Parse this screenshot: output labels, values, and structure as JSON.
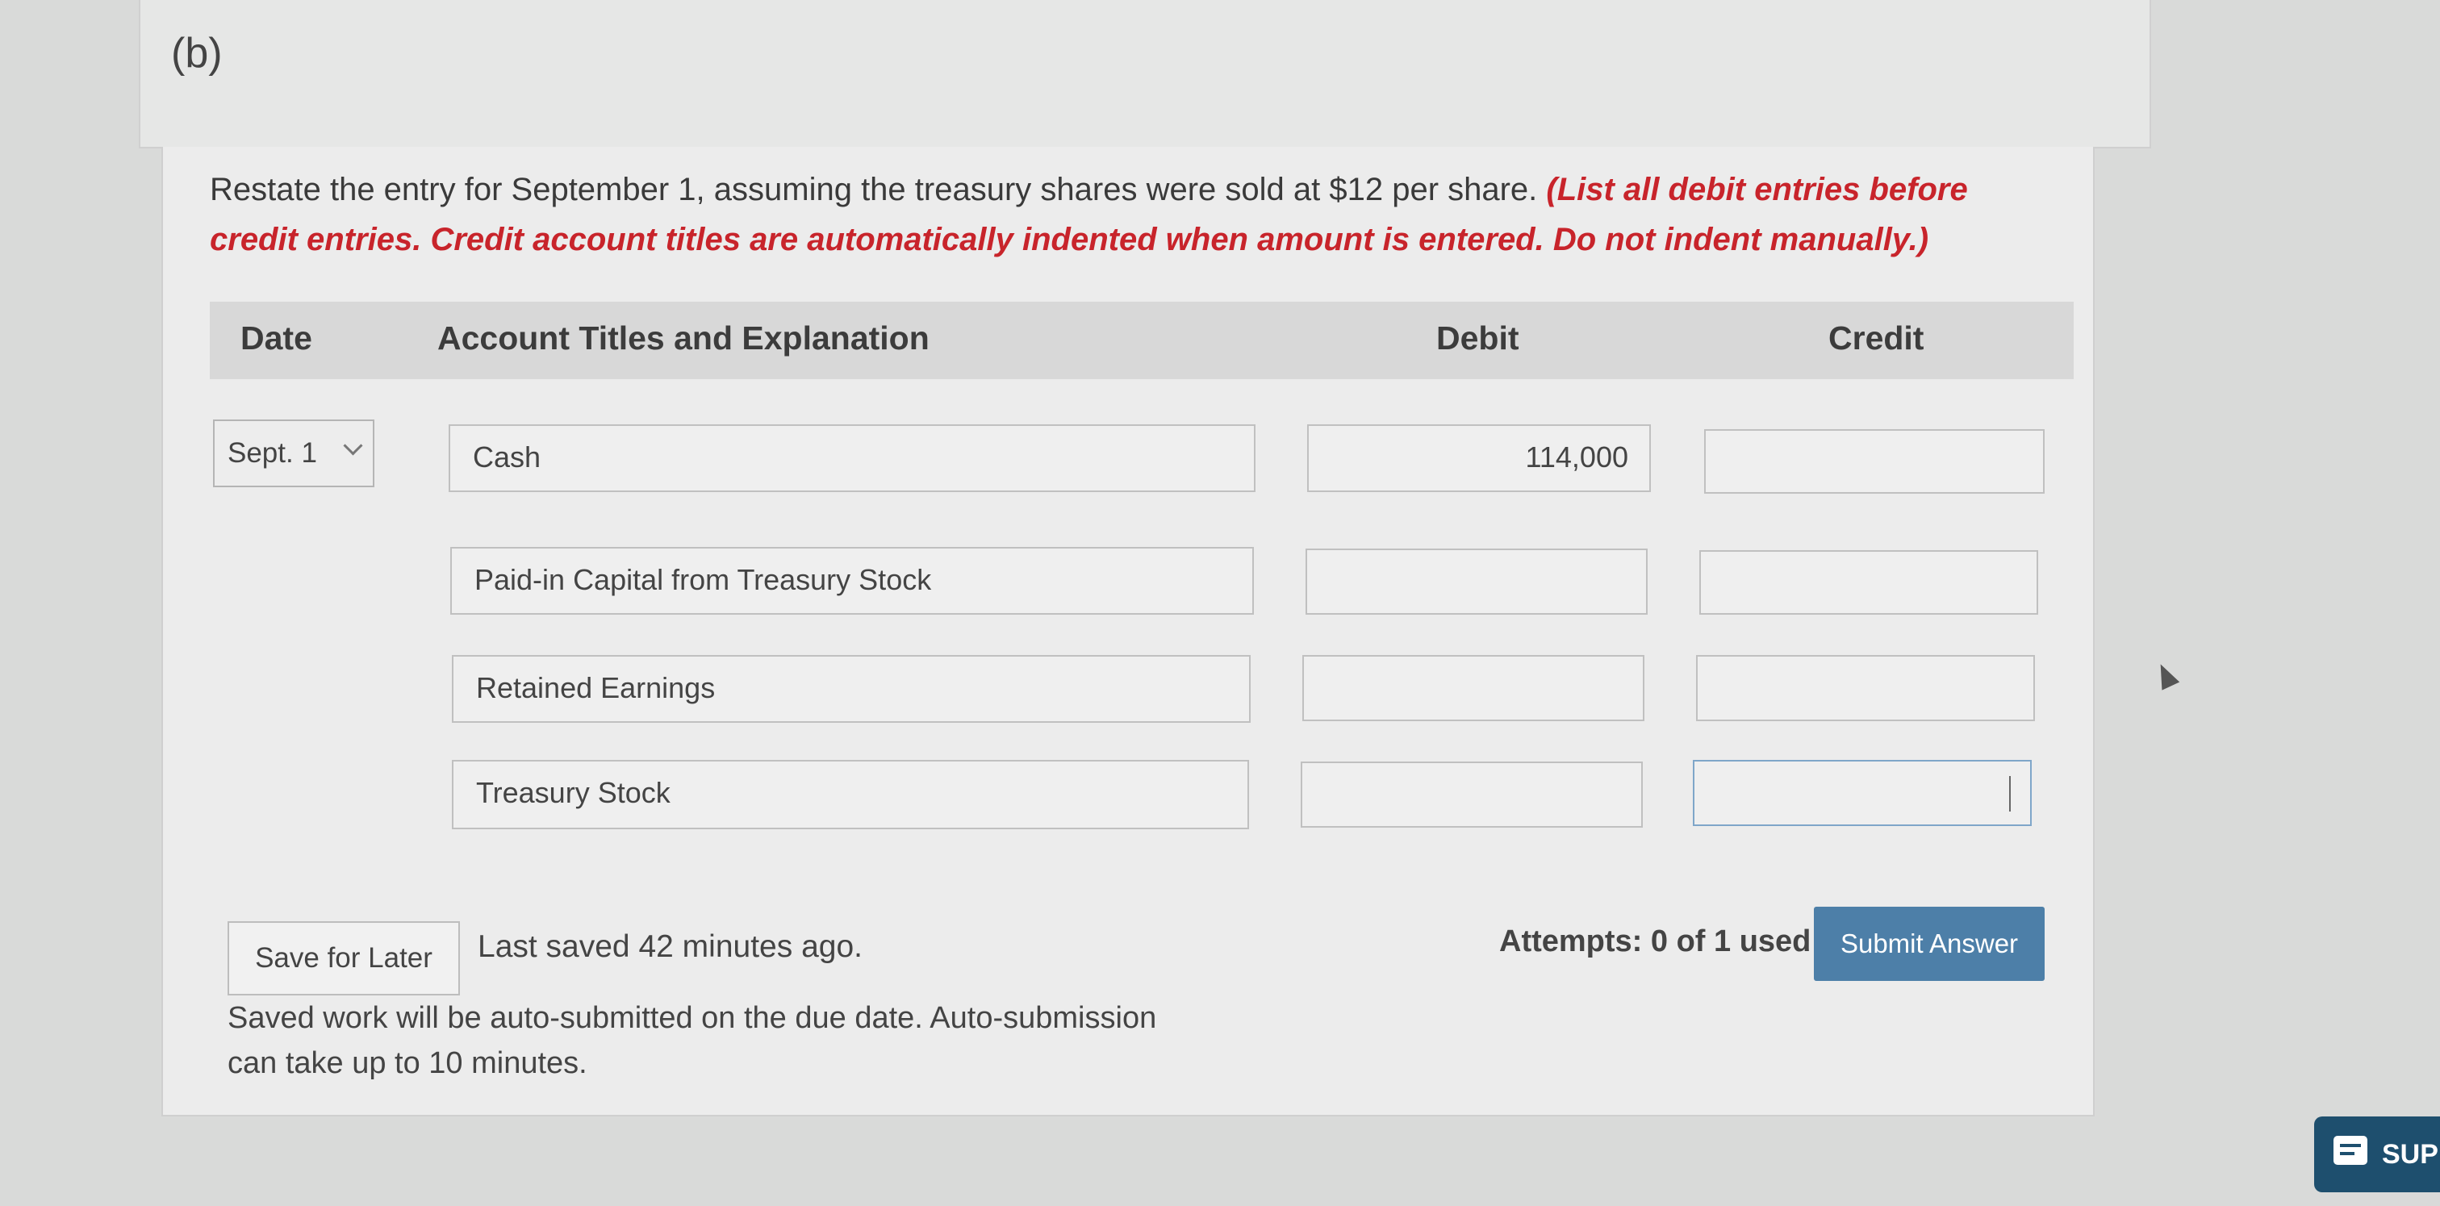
{
  "part_label": "(b)",
  "instructions": {
    "main": "Restate the entry for September 1, assuming the treasury shares were sold at $12 per share.",
    "note": "(List all debit entries before credit entries. Credit account titles are automatically indented when amount is entered. Do not indent manually.)"
  },
  "table": {
    "headers": {
      "date": "Date",
      "account": "Account Titles and Explanation",
      "debit": "Debit",
      "credit": "Credit"
    },
    "date_value": "Sept. 1",
    "rows": [
      {
        "account": "Cash",
        "debit": "114,000",
        "credit": ""
      },
      {
        "account": "Paid-in Capital from Treasury Stock",
        "debit": "",
        "credit": ""
      },
      {
        "account": "Retained Earnings",
        "debit": "",
        "credit": ""
      },
      {
        "account": "Treasury Stock",
        "debit": "",
        "credit": ""
      }
    ]
  },
  "footer": {
    "save_button": "Save for Later",
    "last_saved": "Last saved 42 minutes ago.",
    "auto_submit_note": "Saved work will be auto-submitted on the due date. Auto-submission can take up to 10 minutes.",
    "attempts": "Attempts: 0 of 1 used",
    "submit_button": "Submit Answer"
  },
  "support_label": "SUP",
  "colors": {
    "accent_button": "#4d7fa8",
    "instruction_red": "#c8242b",
    "support_bg": "#1e4f6e"
  }
}
